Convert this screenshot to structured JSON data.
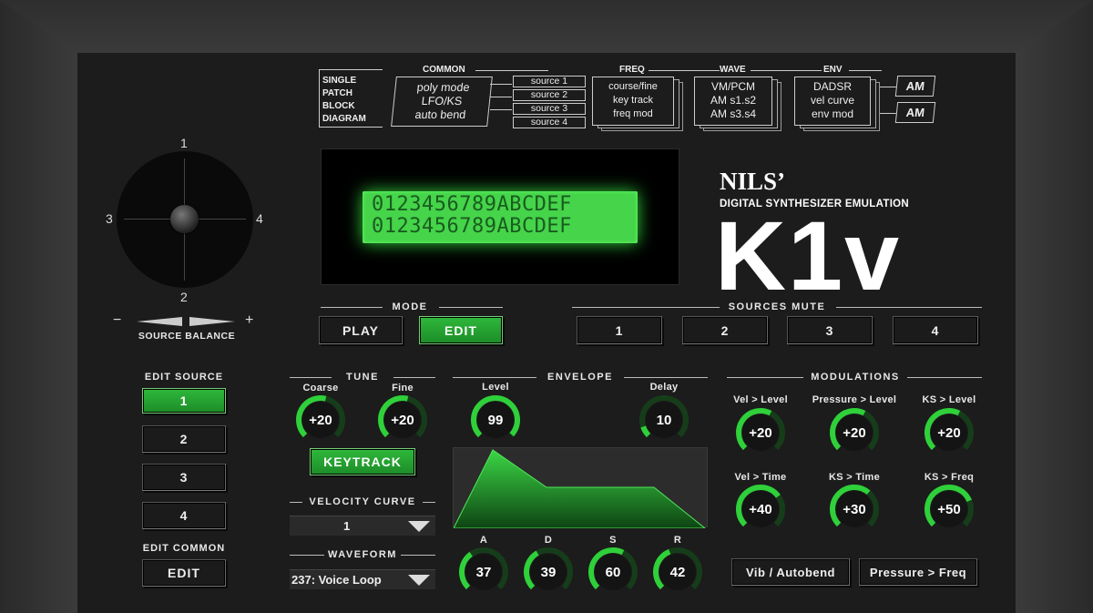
{
  "diagram": {
    "title_lines": [
      "SINGLE",
      "PATCH",
      "BLOCK",
      "DIAGRAM"
    ],
    "common": {
      "label": "COMMON",
      "items": [
        "poly mode",
        "LFO/KS",
        "auto bend"
      ]
    },
    "sources": [
      "source 1",
      "source 2",
      "source 3",
      "source 4"
    ],
    "freq": {
      "label": "FREQ",
      "items": [
        "course/fine",
        "key track",
        "freq mod"
      ]
    },
    "wave": {
      "label": "WAVE",
      "items": [
        "VM/PCM",
        "AM s1.s2",
        "AM s3.s4"
      ]
    },
    "env": {
      "label": "ENV",
      "items": [
        "DADSR",
        "vel curve",
        "env mod"
      ]
    },
    "am": [
      "AM",
      "AM"
    ]
  },
  "lcd": {
    "line1": "0123456789ABCDEF",
    "line2": "0123456789ABCDEF"
  },
  "brand": {
    "name": "NILS’",
    "subtitle": "DIGITAL  SYNTHESIZER  EMULATION",
    "model": "K1v"
  },
  "joystick": {
    "labels": {
      "top": "1",
      "left": "3",
      "right": "4",
      "bottom": "2"
    }
  },
  "source_balance": {
    "label": "SOURCE BALANCE",
    "minus": "−",
    "plus": "+"
  },
  "mode": {
    "label": "MODE",
    "play": "PLAY",
    "edit": "EDIT",
    "active": "EDIT"
  },
  "sources_mute": {
    "label": "SOURCES MUTE",
    "buttons": [
      "1",
      "2",
      "3",
      "4"
    ]
  },
  "edit_source": {
    "label": "EDIT SOURCE",
    "buttons": [
      "1",
      "2",
      "3",
      "4"
    ],
    "active": "1"
  },
  "edit_common": {
    "label": "EDIT COMMON",
    "button": "EDIT"
  },
  "tune": {
    "label": "TUNE",
    "coarse": {
      "label": "Coarse",
      "value": "+20"
    },
    "fine": {
      "label": "Fine",
      "value": "+20"
    },
    "keytrack": "KEYTRACK"
  },
  "velocity_curve": {
    "label": "VELOCITY CURVE",
    "value": "1"
  },
  "waveform": {
    "label": "WAVEFORM",
    "value": "237: Voice Loop"
  },
  "envelope": {
    "label": "ENVELOPE",
    "level": {
      "label": "Level",
      "value": "99"
    },
    "delay": {
      "label": "Delay",
      "value": "10"
    },
    "a": {
      "label": "A",
      "value": "37"
    },
    "d": {
      "label": "D",
      "value": "39"
    },
    "s": {
      "label": "S",
      "value": "60"
    },
    "r": {
      "label": "R",
      "value": "42"
    }
  },
  "modulations": {
    "label": "MODULATIONS",
    "vel_level": {
      "label": "Vel > Level",
      "value": "+20"
    },
    "pressure_level": {
      "label": "Pressure > Level",
      "value": "+20"
    },
    "ks_level": {
      "label": "KS > Level",
      "value": "+20"
    },
    "vel_time": {
      "label": "Vel > Time",
      "value": "+40"
    },
    "ks_time": {
      "label": "KS > Time",
      "value": "+30"
    },
    "ks_freq": {
      "label": "KS > Freq",
      "value": "+50"
    },
    "vib_autobend": "Vib / Autobend",
    "pressure_freq": "Pressure > Freq"
  },
  "colors": {
    "accent": "#2fd03a",
    "lcd": "#45d44a",
    "panel": "#1c1c1c"
  }
}
